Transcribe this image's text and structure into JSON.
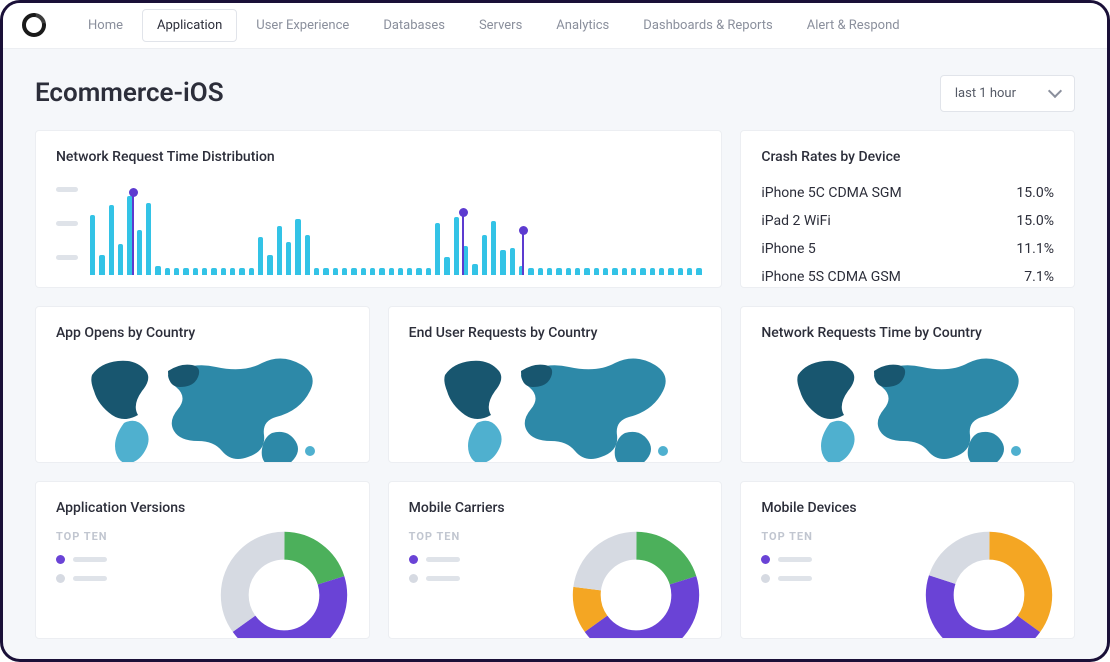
{
  "nav": {
    "items": [
      "Home",
      "Application",
      "User Experience",
      "Databases",
      "Servers",
      "Analytics",
      "Dashboards & Reports",
      "Alert & Respond"
    ],
    "active_index": 1
  },
  "page": {
    "title": "Ecommerce-iOS",
    "time_range": "last 1 hour"
  },
  "cards": {
    "distribution_title": "Network Request Time Distribution",
    "crash_title": "Crash Rates by Device",
    "map1_title": "App Opens by Country",
    "map2_title": "End User Requests by Country",
    "map3_title": "Network Requests Time by Country",
    "donut1_title": "Application Versions",
    "donut2_title": "Mobile Carriers",
    "donut3_title": "Mobile Devices",
    "legend_heading": "TOP TEN"
  },
  "crash_rates": [
    {
      "device": "iPhone 5C CDMA SGM",
      "rate": "15.0%"
    },
    {
      "device": "iPad 2 WiFi",
      "rate": "15.0%"
    },
    {
      "device": "iPhone 5",
      "rate": "11.1%"
    },
    {
      "device": "iPhone 5S CDMA GSM",
      "rate": "7.1%"
    }
  ],
  "chart_data": {
    "distribution": {
      "type": "bar",
      "title": "Network Request Time Distribution",
      "xlabel": "",
      "ylabel": "",
      "values": [
        66,
        22,
        78,
        34,
        88,
        50,
        80,
        10,
        8,
        8,
        8,
        8,
        8,
        8,
        8,
        8,
        8,
        8,
        42,
        22,
        54,
        36,
        62,
        44,
        8,
        8,
        8,
        8,
        8,
        8,
        8,
        8,
        8,
        8,
        8,
        8,
        8,
        58,
        20,
        64,
        32,
        12,
        44,
        60,
        28,
        30,
        10,
        8,
        8,
        8,
        8,
        8,
        8,
        8,
        8,
        8,
        8,
        8,
        8,
        8,
        8,
        8,
        8,
        8,
        8,
        8
      ],
      "markers": [
        {
          "index": 4,
          "value": 92
        },
        {
          "index": 37,
          "value": 70
        },
        {
          "index": 43,
          "value": 50
        }
      ]
    },
    "donuts": {
      "application_versions": {
        "type": "pie",
        "series": [
          {
            "name": "segment-1",
            "value": 20,
            "color": "#4cb05b"
          },
          {
            "name": "segment-2",
            "value": 45,
            "color": "#6a43d6"
          },
          {
            "name": "segment-3",
            "value": 35,
            "color": "#d6dae2"
          }
        ]
      },
      "mobile_carriers": {
        "type": "pie",
        "series": [
          {
            "name": "segment-1",
            "value": 20,
            "color": "#4cb05b"
          },
          {
            "name": "segment-2",
            "value": 45,
            "color": "#6a43d6"
          },
          {
            "name": "segment-3",
            "value": 12,
            "color": "#f4a623"
          },
          {
            "name": "segment-4",
            "value": 23,
            "color": "#d6dae2"
          }
        ]
      },
      "mobile_devices": {
        "type": "pie",
        "series": [
          {
            "name": "segment-1",
            "value": 35,
            "color": "#f4a623"
          },
          {
            "name": "segment-2",
            "value": 45,
            "color": "#6a43d6"
          },
          {
            "name": "segment-3",
            "value": 20,
            "color": "#d6dae2"
          }
        ]
      }
    }
  },
  "colors": {
    "bar": "#33c3e6",
    "marker": "#5d3bd0",
    "map_dark": "#18566f",
    "map_mid": "#2d89a8",
    "map_light": "#4fb0cf"
  }
}
